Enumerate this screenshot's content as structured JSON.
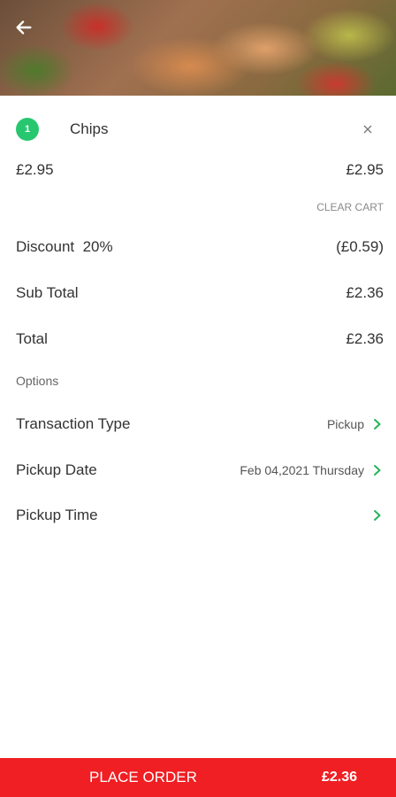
{
  "cart": {
    "items": [
      {
        "qty": "1",
        "name": "Chips",
        "unit_price": "£2.95",
        "line_total": "£2.95"
      }
    ],
    "clear_label": "CLEAR CART"
  },
  "summary": {
    "discount_label": "Discount  20%",
    "discount_value": "(£0.59)",
    "subtotal_label": "Sub Total",
    "subtotal_value": "£2.36",
    "total_label": "Total",
    "total_value": "£2.36"
  },
  "options": {
    "heading": "Options",
    "transaction_type_label": "Transaction Type",
    "transaction_type_value": "Pickup",
    "pickup_date_label": "Pickup Date",
    "pickup_date_value": "Feb 04,2021 Thursday",
    "pickup_time_label": "Pickup Time",
    "pickup_time_value": ""
  },
  "footer": {
    "place_order_label": "PLACE ORDER",
    "amount": "£2.36"
  },
  "colors": {
    "accent_green": "#27c76f",
    "chevron_green": "#22b45a",
    "place_order_red": "#ef1f23"
  },
  "icons": {
    "back": "arrow-left-icon",
    "remove": "close-icon",
    "chevron": "chevron-right-icon"
  }
}
